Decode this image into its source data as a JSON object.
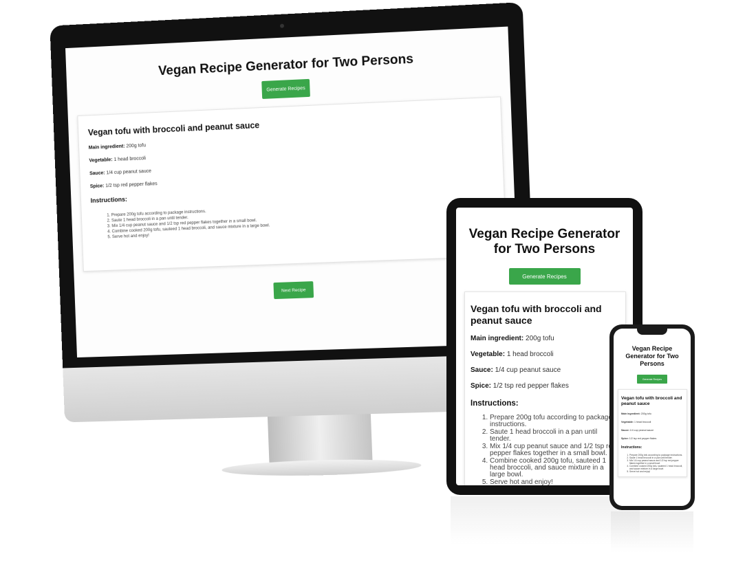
{
  "app": {
    "title": "Vegan Recipe Generator for Two Persons",
    "generate_label_desktop": "Generate Recipes",
    "generate_label": "Generate Recipes",
    "next_label": "Next Recipe"
  },
  "recipe": {
    "title": "Vegan tofu with broccoli and peanut sauce",
    "main_label": "Main ingredient:",
    "main_value": "200g tofu",
    "vegetable_label": "Vegetable:",
    "vegetable_value": "1 head broccoli",
    "sauce_label": "Sauce:",
    "sauce_value": "1/4 cup peanut sauce",
    "spice_label": "Spice:",
    "spice_value": "1/2 tsp red pepper flakes",
    "instructions_heading": "Instructions:",
    "steps": [
      "Prepare 200g tofu according to package instructions.",
      "Saute 1 head broccoli in a pan until tender.",
      "Mix 1/4 cup peanut sauce and 1/2 tsp red pepper flakes together in a small bowl.",
      "Combine cooked 200g tofu, sauteed 1 head broccoli, and sauce mixture in a large bowl.",
      "Serve hot and enjoy!"
    ]
  },
  "colors": {
    "accent_green": "#3aa64a",
    "device_frame": "#111111"
  }
}
